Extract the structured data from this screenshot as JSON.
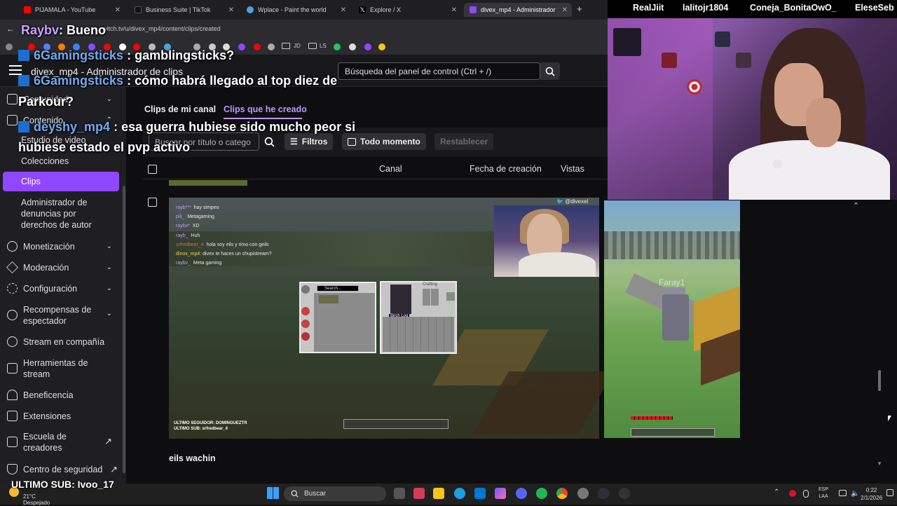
{
  "browser": {
    "tabs": [
      {
        "title": "PIJAMALA - YouTube",
        "color": "#ff0000"
      },
      {
        "title": "Business Suite | TikTok",
        "color": "#000000"
      },
      {
        "title": "Wplace - Paint the world",
        "color": "#4aa3df"
      },
      {
        "title": "Explore / X",
        "color": "#000000"
      },
      {
        "title": "divex_mp4 - Administrador",
        "color": "#9147ff"
      }
    ],
    "url": "witch.tv/u/divex_mp4/content/clips/created",
    "bookmarks": [
      "JD",
      "LS"
    ]
  },
  "dashboard": {
    "header_title": "divex_mp4 - Administrador de clips",
    "search_placeholder": "Búsqueda del panel de control (Ctrl + /)",
    "sidebar": {
      "comunidad": "Comunidad",
      "contenido": "Contenido",
      "sub": [
        "Estudio de video",
        "Colecciones",
        "Clips",
        "Administrador de denuncias por derechos de autor"
      ],
      "items": [
        "Monetización",
        "Moderación",
        "Configuración",
        "Recompensas de espectador",
        "Stream en compañía",
        "Herramientas de stream",
        "Beneficencia",
        "Extensiones",
        "Escuela de creadores",
        "Centro de seguridad"
      ]
    },
    "tabs": [
      "Clips de mi canal",
      "Clips que he creado"
    ],
    "filter": {
      "search_placeholder": "Buscar por título o catego",
      "filters": "Filtros",
      "time": "Todo momento",
      "reset": "Restablecer"
    },
    "table_headers": {
      "canal": "Canal",
      "fecha": "Fecha de creación",
      "vistas": "Vistas"
    },
    "clip": {
      "title": "eils wachin",
      "watermark": "@divexel",
      "ingame_chat": [
        {
          "user": "rayb***",
          "text": "hay simpeo"
        },
        {
          "user": "pili_",
          "text": "Metagaming"
        },
        {
          "user": "raybv*",
          "text": "XD"
        },
        {
          "user": "rayb_",
          "text": "Huh"
        },
        {
          "user": "srfredbear_4",
          "text": "hola soy eils y rimo con geils"
        },
        {
          "user": "dinox_mp4:",
          "text": "divex te haces un chupistream?"
        },
        {
          "user": "raybv_",
          "text": "Meta gaming"
        }
      ],
      "hud_follower": "ULTIMO SEGUIDOR: DOMINGUEZTR",
      "hud_sub": "ULTIMO SUB: srfredbear_4",
      "inv_search": "Search...",
      "crafting": "Crafting",
      "birch": "Birch Log",
      "player_tag": "Faray1"
    }
  },
  "stream_overlay": {
    "top_names": [
      "RealJiit",
      "lalitojr1804",
      "Coneja_BonitaOwO_",
      "EleseSeb"
    ],
    "chat": [
      {
        "user": "Raybv",
        "text": ": Bueno"
      },
      {
        "user": "6Gamingsticks",
        "text": ": gamblingsticks?"
      },
      {
        "user": "6Gamingsticks",
        "text": ": cómo habrá llegado al top diez de"
      },
      {
        "user": "",
        "text": "Parkour?"
      },
      {
        "user": "deyshy_mp4",
        "text": ": esa guerra hubiese sido mucho peor si"
      },
      {
        "user": "",
        "text": "hubiese estado el pvp activo"
      }
    ],
    "ultimo_sub": "ULTIMO SUB: Ivoo_17"
  },
  "taskbar": {
    "weather_temp": "21°C",
    "weather_text": "Despejado",
    "search": "Buscar",
    "lang1": "ESP",
    "lang2": "LAA",
    "time": "0:22",
    "date": "2/1/2026"
  }
}
